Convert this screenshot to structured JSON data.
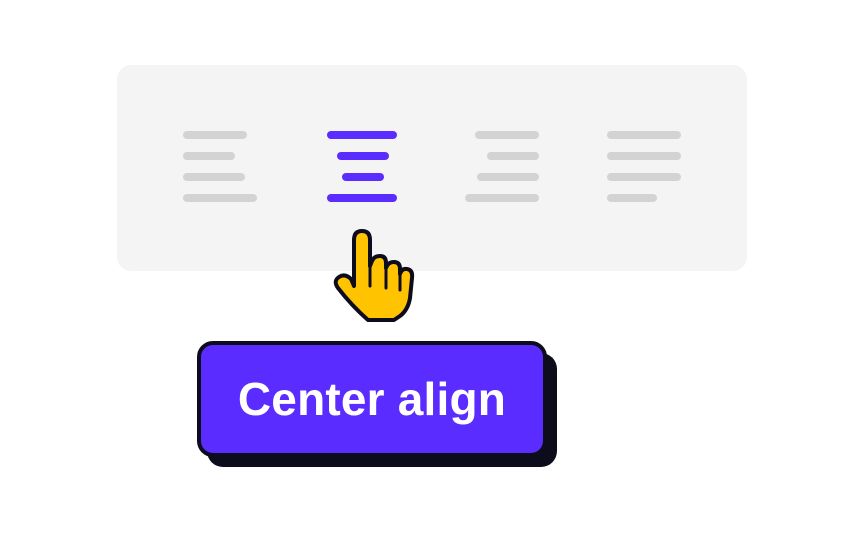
{
  "toolbar": {
    "options": [
      {
        "name": "align-left",
        "icon": "align-left-icon",
        "selected": false
      },
      {
        "name": "align-center",
        "icon": "align-center-icon",
        "selected": true
      },
      {
        "name": "align-right",
        "icon": "align-right-icon",
        "selected": false
      },
      {
        "name": "align-justify",
        "icon": "align-justify-icon",
        "selected": false
      }
    ]
  },
  "cursor": {
    "icon": "pointing-hand-cursor-icon"
  },
  "cta": {
    "label": "Center align"
  },
  "colors": {
    "accent": "#5a2cff",
    "inactive": "#d3d3d3",
    "panel": "#f4f4f4",
    "outline": "#0d0c1d",
    "cursor_fill": "#ffc300"
  }
}
